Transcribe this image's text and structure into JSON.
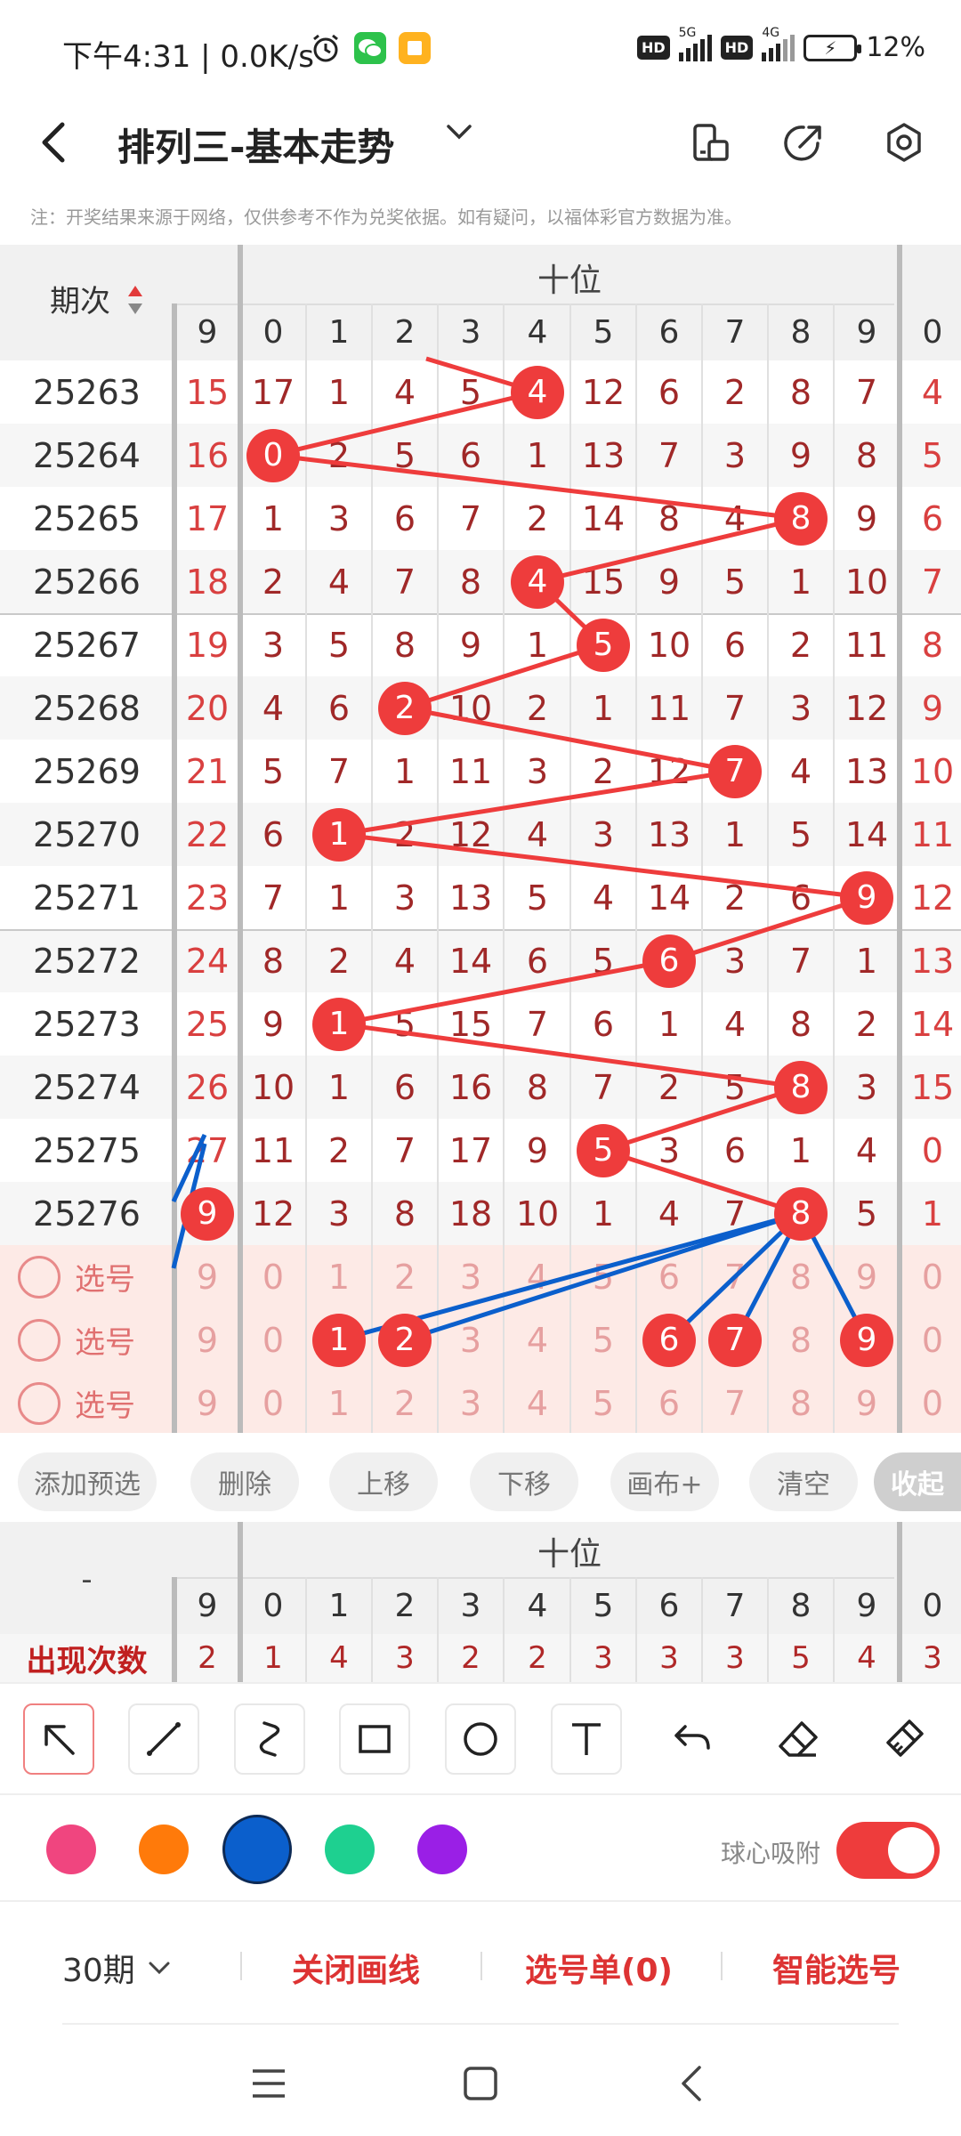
{
  "status": {
    "time": "下午4:31 | 0.0K/s",
    "battery": "12%",
    "net1": "5G",
    "net2": "4G",
    "hd": "HD"
  },
  "header": {
    "title": "排列三-基本走势"
  },
  "notice": "注：开奖结果来源于网络，仅供参考不作为兑奖依据。如有疑问，以福体彩官方数据为准。",
  "table": {
    "issue_header": "期次",
    "group_label": "十位",
    "col_headers": [
      "9",
      "0",
      "1",
      "2",
      "3",
      "4",
      "5",
      "6",
      "7",
      "8",
      "9",
      "0"
    ],
    "rows": [
      {
        "issue": "25263",
        "cells": [
          "15",
          "17",
          "1",
          "4",
          "5",
          "4",
          "12",
          "6",
          "2",
          "8",
          "7",
          "4"
        ]
      },
      {
        "issue": "25264",
        "cells": [
          "16",
          "0",
          "2",
          "5",
          "6",
          "1",
          "13",
          "7",
          "3",
          "9",
          "8",
          "5"
        ]
      },
      {
        "issue": "25265",
        "cells": [
          "17",
          "1",
          "3",
          "6",
          "7",
          "2",
          "14",
          "8",
          "4",
          "8",
          "9",
          "6"
        ]
      },
      {
        "issue": "25266",
        "cells": [
          "18",
          "2",
          "4",
          "7",
          "8",
          "4",
          "15",
          "9",
          "5",
          "1",
          "10",
          "7"
        ]
      },
      {
        "issue": "25267",
        "cells": [
          "19",
          "3",
          "5",
          "8",
          "9",
          "1",
          "5",
          "10",
          "6",
          "2",
          "11",
          "8"
        ]
      },
      {
        "issue": "25268",
        "cells": [
          "20",
          "4",
          "6",
          "2",
          "10",
          "2",
          "1",
          "11",
          "7",
          "3",
          "12",
          "9"
        ]
      },
      {
        "issue": "25269",
        "cells": [
          "21",
          "5",
          "7",
          "1",
          "11",
          "3",
          "2",
          "12",
          "7",
          "4",
          "13",
          "10"
        ]
      },
      {
        "issue": "25270",
        "cells": [
          "22",
          "6",
          "1",
          "2",
          "12",
          "4",
          "3",
          "13",
          "1",
          "5",
          "14",
          "11"
        ]
      },
      {
        "issue": "25271",
        "cells": [
          "23",
          "7",
          "1",
          "3",
          "13",
          "5",
          "4",
          "14",
          "2",
          "6",
          "9",
          "12"
        ]
      },
      {
        "issue": "25272",
        "cells": [
          "24",
          "8",
          "2",
          "4",
          "14",
          "6",
          "5",
          "6",
          "3",
          "7",
          "1",
          "13"
        ]
      },
      {
        "issue": "25273",
        "cells": [
          "25",
          "9",
          "1",
          "5",
          "15",
          "7",
          "6",
          "1",
          "4",
          "8",
          "2",
          "14"
        ]
      },
      {
        "issue": "25274",
        "cells": [
          "26",
          "10",
          "1",
          "6",
          "16",
          "8",
          "7",
          "2",
          "5",
          "8",
          "3",
          "15"
        ]
      },
      {
        "issue": "25275",
        "cells": [
          "27",
          "11",
          "2",
          "7",
          "17",
          "9",
          "5",
          "3",
          "6",
          "1",
          "4",
          "0"
        ]
      },
      {
        "issue": "25276",
        "cells": [
          "9",
          "12",
          "3",
          "8",
          "18",
          "10",
          "1",
          "4",
          "7",
          "8",
          "5",
          "1"
        ]
      }
    ],
    "hit_cols": [
      5,
      1,
      9,
      5,
      6,
      3,
      8,
      2,
      10,
      7,
      2,
      9,
      6,
      9
    ],
    "select_label": "选号",
    "select_rows": [
      [
        "9",
        "0",
        "1",
        "2",
        "3",
        "4",
        "5",
        "6",
        "7",
        "8",
        "9",
        "0"
      ],
      [
        "9",
        "0",
        "1",
        "2",
        "3",
        "4",
        "5",
        "6",
        "7",
        "8",
        "9",
        "0"
      ],
      [
        "9",
        "0",
        "1",
        "2",
        "3",
        "4",
        "5",
        "6",
        "7",
        "8",
        "9",
        "0"
      ]
    ],
    "selected_balls": [
      2,
      3,
      7,
      8,
      10
    ]
  },
  "actions": [
    "添加预选",
    "删除",
    "上移",
    "下移",
    "画布+",
    "清空",
    "收起"
  ],
  "stats": {
    "dash": "-",
    "group_label": "十位",
    "col_headers": [
      "9",
      "0",
      "1",
      "2",
      "3",
      "4",
      "5",
      "6",
      "7",
      "8",
      "9",
      "0"
    ],
    "label": "出现次数",
    "values": [
      "2",
      "1",
      "4",
      "3",
      "2",
      "2",
      "3",
      "3",
      "3",
      "5",
      "4",
      "3"
    ]
  },
  "tools": [
    "pointer-icon",
    "line-icon",
    "curve-icon",
    "rectangle-icon",
    "circle-icon",
    "text-icon",
    "undo-icon",
    "eraser-icon",
    "clear-icon"
  ],
  "colors": {
    "pink": "#f0457f",
    "orange": "#ff7a0a",
    "blue": "#0b5fcc",
    "green": "#1ed090",
    "purple": "#9a1fe6",
    "accent": "#ee3c3c"
  },
  "snap_label": "球心吸附",
  "bottom": {
    "period": "30期",
    "close_lines": "关闭画线",
    "selection_list": "选号单(0)",
    "smart_pick": "智能选号"
  }
}
